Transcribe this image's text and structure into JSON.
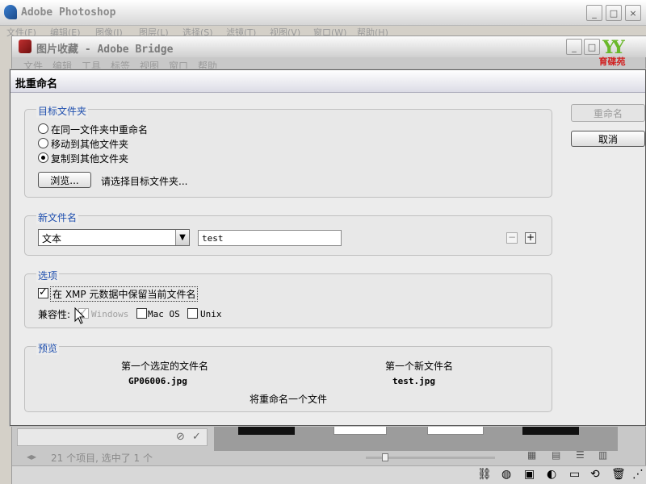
{
  "photoshop": {
    "title": "Adobe Photoshop",
    "menu": [
      "文件(F)",
      "编辑(E)",
      "图像(I)",
      "图层(L)",
      "选择(S)",
      "滤镜(T)",
      "视图(V)",
      "窗口(W)",
      "帮助(H)"
    ],
    "controls": {
      "minimize": "_",
      "maximize": "□",
      "close": "×"
    }
  },
  "bridge": {
    "title": "图片收藏 - Adobe Bridge",
    "menu": [
      "文件",
      "编辑",
      "工具",
      "标签",
      "视图",
      "窗口",
      "帮助"
    ],
    "status": "21 个项目, 选中了 1 个",
    "watermark": "育碟苑"
  },
  "dialog": {
    "title": "批重命名",
    "buttons": {
      "rename": "重命名",
      "cancel": "取消"
    },
    "target_folder": {
      "label": "目标文件夹",
      "options": [
        "在同一文件夹中重命名",
        "移动到其他文件夹",
        "复制到其他文件夹"
      ],
      "selected_index": 2,
      "browse": "浏览...",
      "hint": "请选择目标文件夹..."
    },
    "new_filename": {
      "label": "新文件名",
      "type_value": "文本",
      "text_value": "test",
      "minus": "−",
      "plus": "+"
    },
    "options": {
      "label": "选项",
      "keep_xmp_label": "在 XMP 元数据中保留当前文件名",
      "keep_xmp_checked": true,
      "compat_label": "兼容性:",
      "windows": "Windows",
      "windows_checked": true,
      "macos": "Mac OS",
      "macos_checked": false,
      "unix": "Unix",
      "unix_checked": false
    },
    "preview": {
      "label": "预览",
      "first_selected_header": "第一个选定的文件名",
      "first_selected_value": "GP06006.jpg",
      "first_new_header": "第一个新文件名",
      "first_new_value": "test.jpg",
      "summary": "将重命名一个文件"
    }
  }
}
